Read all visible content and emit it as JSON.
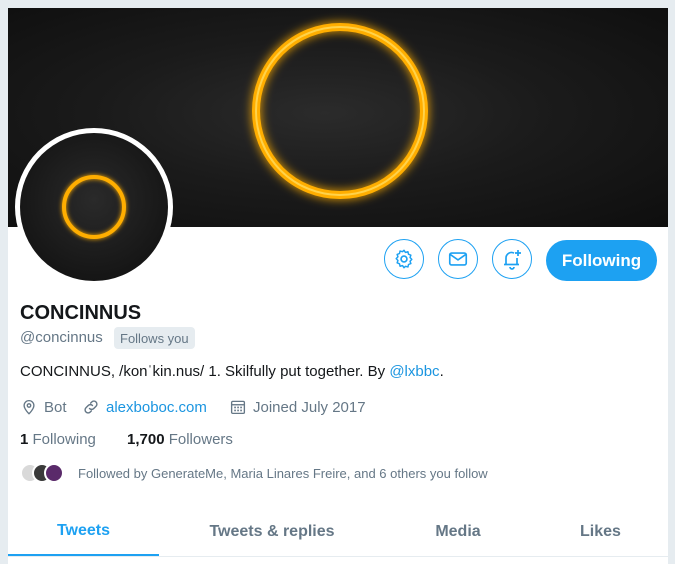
{
  "profile": {
    "name": "CONCINNUS",
    "handle": "@concinnus",
    "follows_you": "Follows you",
    "bio_text": "CONCINNUS, /konˈkin.nus/ 1. Skilfully put together. By ",
    "bio_mention": "@lxbbc",
    "bio_end": ".",
    "location": "Bot",
    "website": "alexboboc.com",
    "joined": "Joined July 2017"
  },
  "stats": {
    "following_count": "1",
    "following_label": "Following",
    "followers_count": "1,700",
    "followers_label": "Followers"
  },
  "followed_by": "Followed by GenerateMe, Maria Linares Freire, and 6 others you follow",
  "actions": {
    "follow_label": "Following",
    "icons": [
      "gear-icon",
      "envelope-icon",
      "bell-plus-icon"
    ]
  },
  "tabs": [
    {
      "label": "Tweets",
      "active": true
    },
    {
      "label": "Tweets & replies",
      "active": false
    },
    {
      "label": "Media",
      "active": false
    },
    {
      "label": "Likes",
      "active": false
    }
  ],
  "colors": {
    "accent": "#1da1f2",
    "ring": "#ffb000",
    "banner": "#151515"
  }
}
